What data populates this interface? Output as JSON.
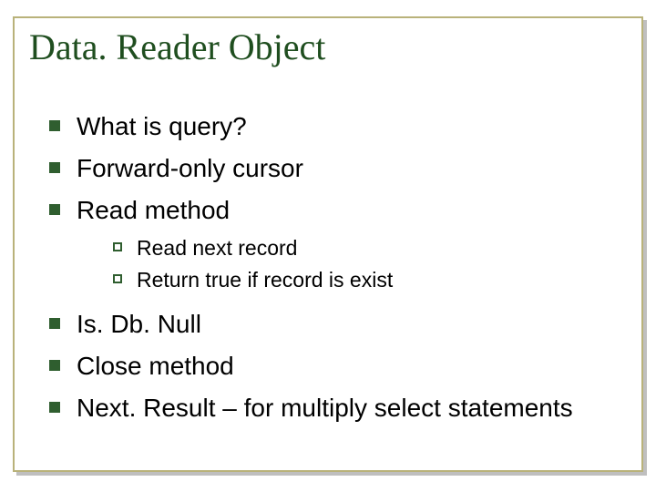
{
  "title": "Data. Reader Object",
  "bullets": {
    "b1": "What is query?",
    "b2": "Forward-only cursor",
    "b3": "Read method",
    "b3_sub": {
      "s1": "Read next record",
      "s2": "Return true if record is exist"
    },
    "b4": "Is. Db. Null",
    "b5": "Close method",
    "b6": "Next. Result – for multiply select statements"
  }
}
